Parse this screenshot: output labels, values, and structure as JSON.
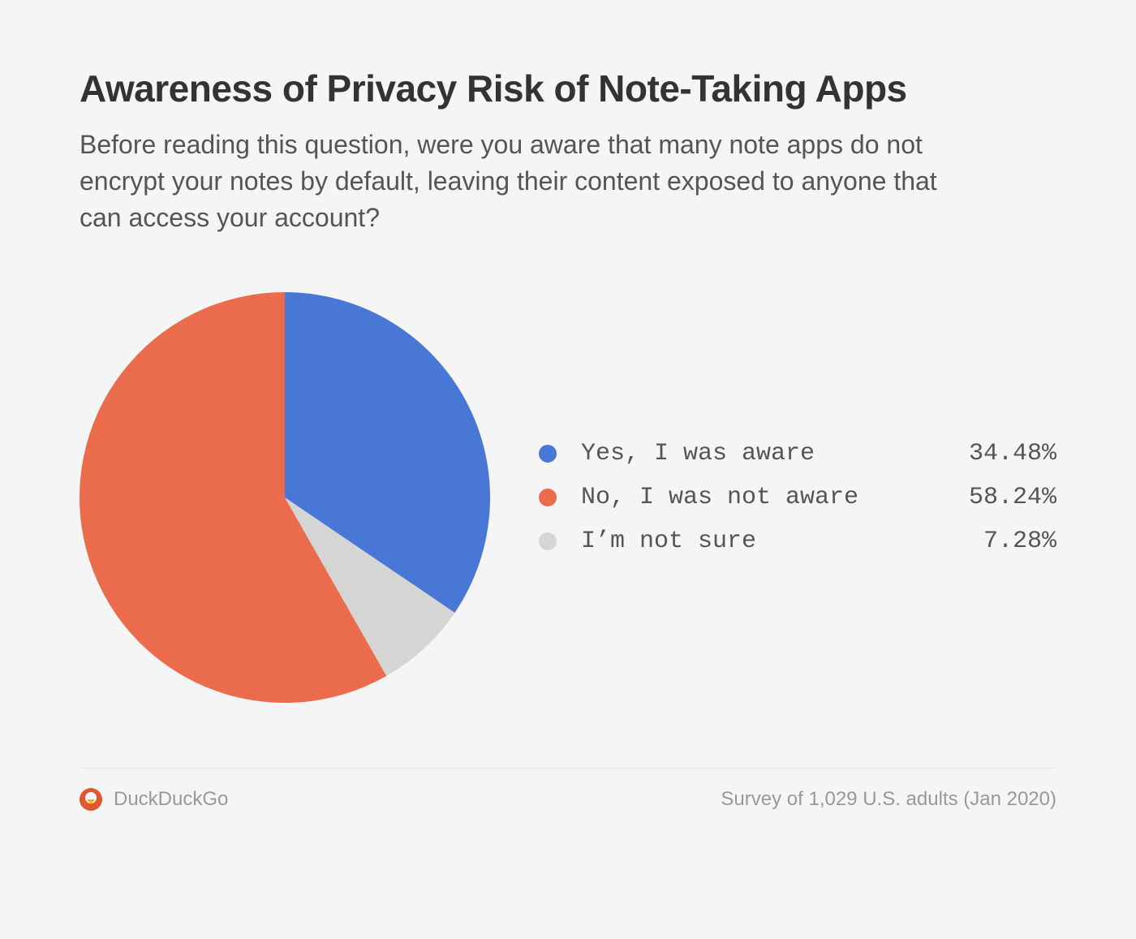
{
  "title": "Awareness of Privacy Risk of Note-Taking Apps",
  "subtitle": "Before reading this question, were you aware that many note apps do not encrypt your notes by default, leaving their content exposed to anyone that can access your account?",
  "footer": {
    "brand": "DuckDuckGo",
    "note": "Survey of 1,029 U.S. adults (Jan 2020)"
  },
  "colors": {
    "blue": "#4977d6",
    "orange": "#ea6c4d",
    "grey": "#d5d5d5"
  },
  "chart_data": {
    "type": "pie",
    "title": "Awareness of Privacy Risk of Note-Taking Apps",
    "series": [
      {
        "name": "Yes, I was aware",
        "value": 34.48,
        "value_label": "34.48%",
        "color_key": "blue"
      },
      {
        "name": "No, I was not aware",
        "value": 58.24,
        "value_label": "58.24%",
        "color_key": "orange"
      },
      {
        "name": "I’m not sure",
        "value": 7.28,
        "value_label": "7.28%",
        "color_key": "grey"
      }
    ],
    "legend_position": "right"
  }
}
